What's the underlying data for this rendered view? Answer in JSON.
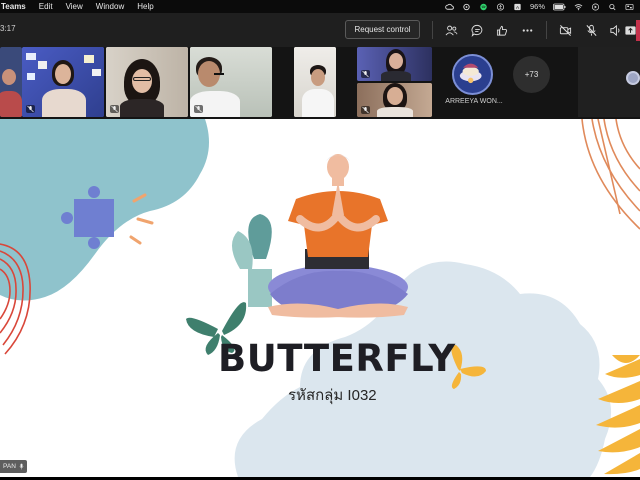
{
  "menubar": {
    "app_name": "Teams",
    "menus": [
      "Edit",
      "View",
      "Window",
      "Help"
    ],
    "battery": "96%",
    "icons": [
      "creative-cloud-icon",
      "sync-icon",
      "spotify-icon",
      "accessibility-icon",
      "text-input-icon",
      "battery-icon",
      "wifi-icon",
      "play-icon",
      "search-icon",
      "display-icon"
    ]
  },
  "toolbar": {
    "timer": "3:17",
    "request_control_label": "Request control",
    "icons": [
      "people-icon",
      "chat-icon",
      "reactions-icon",
      "more-icon",
      "camera-off-icon",
      "mic-off-icon",
      "speaker-icon",
      "share-icon"
    ]
  },
  "participants": {
    "avatar_name": "ARREEYA WON...",
    "more_count": "+73"
  },
  "slide": {
    "title": "BUTTERFLY",
    "subtitle": "รหัสกลุ่ม I032",
    "colors": {
      "blob_blue": "#8fc3cc",
      "cloud": "#dbe6ee",
      "puzzle": "#6f7fd1",
      "shirt": "#e8742a",
      "pants": "#8a8ad6",
      "butterfly_green": "#3f7f6d",
      "butterfly_yellow": "#f5b53a",
      "accent_red": "#d9473a"
    }
  },
  "presenter": {
    "name": "PAN"
  }
}
